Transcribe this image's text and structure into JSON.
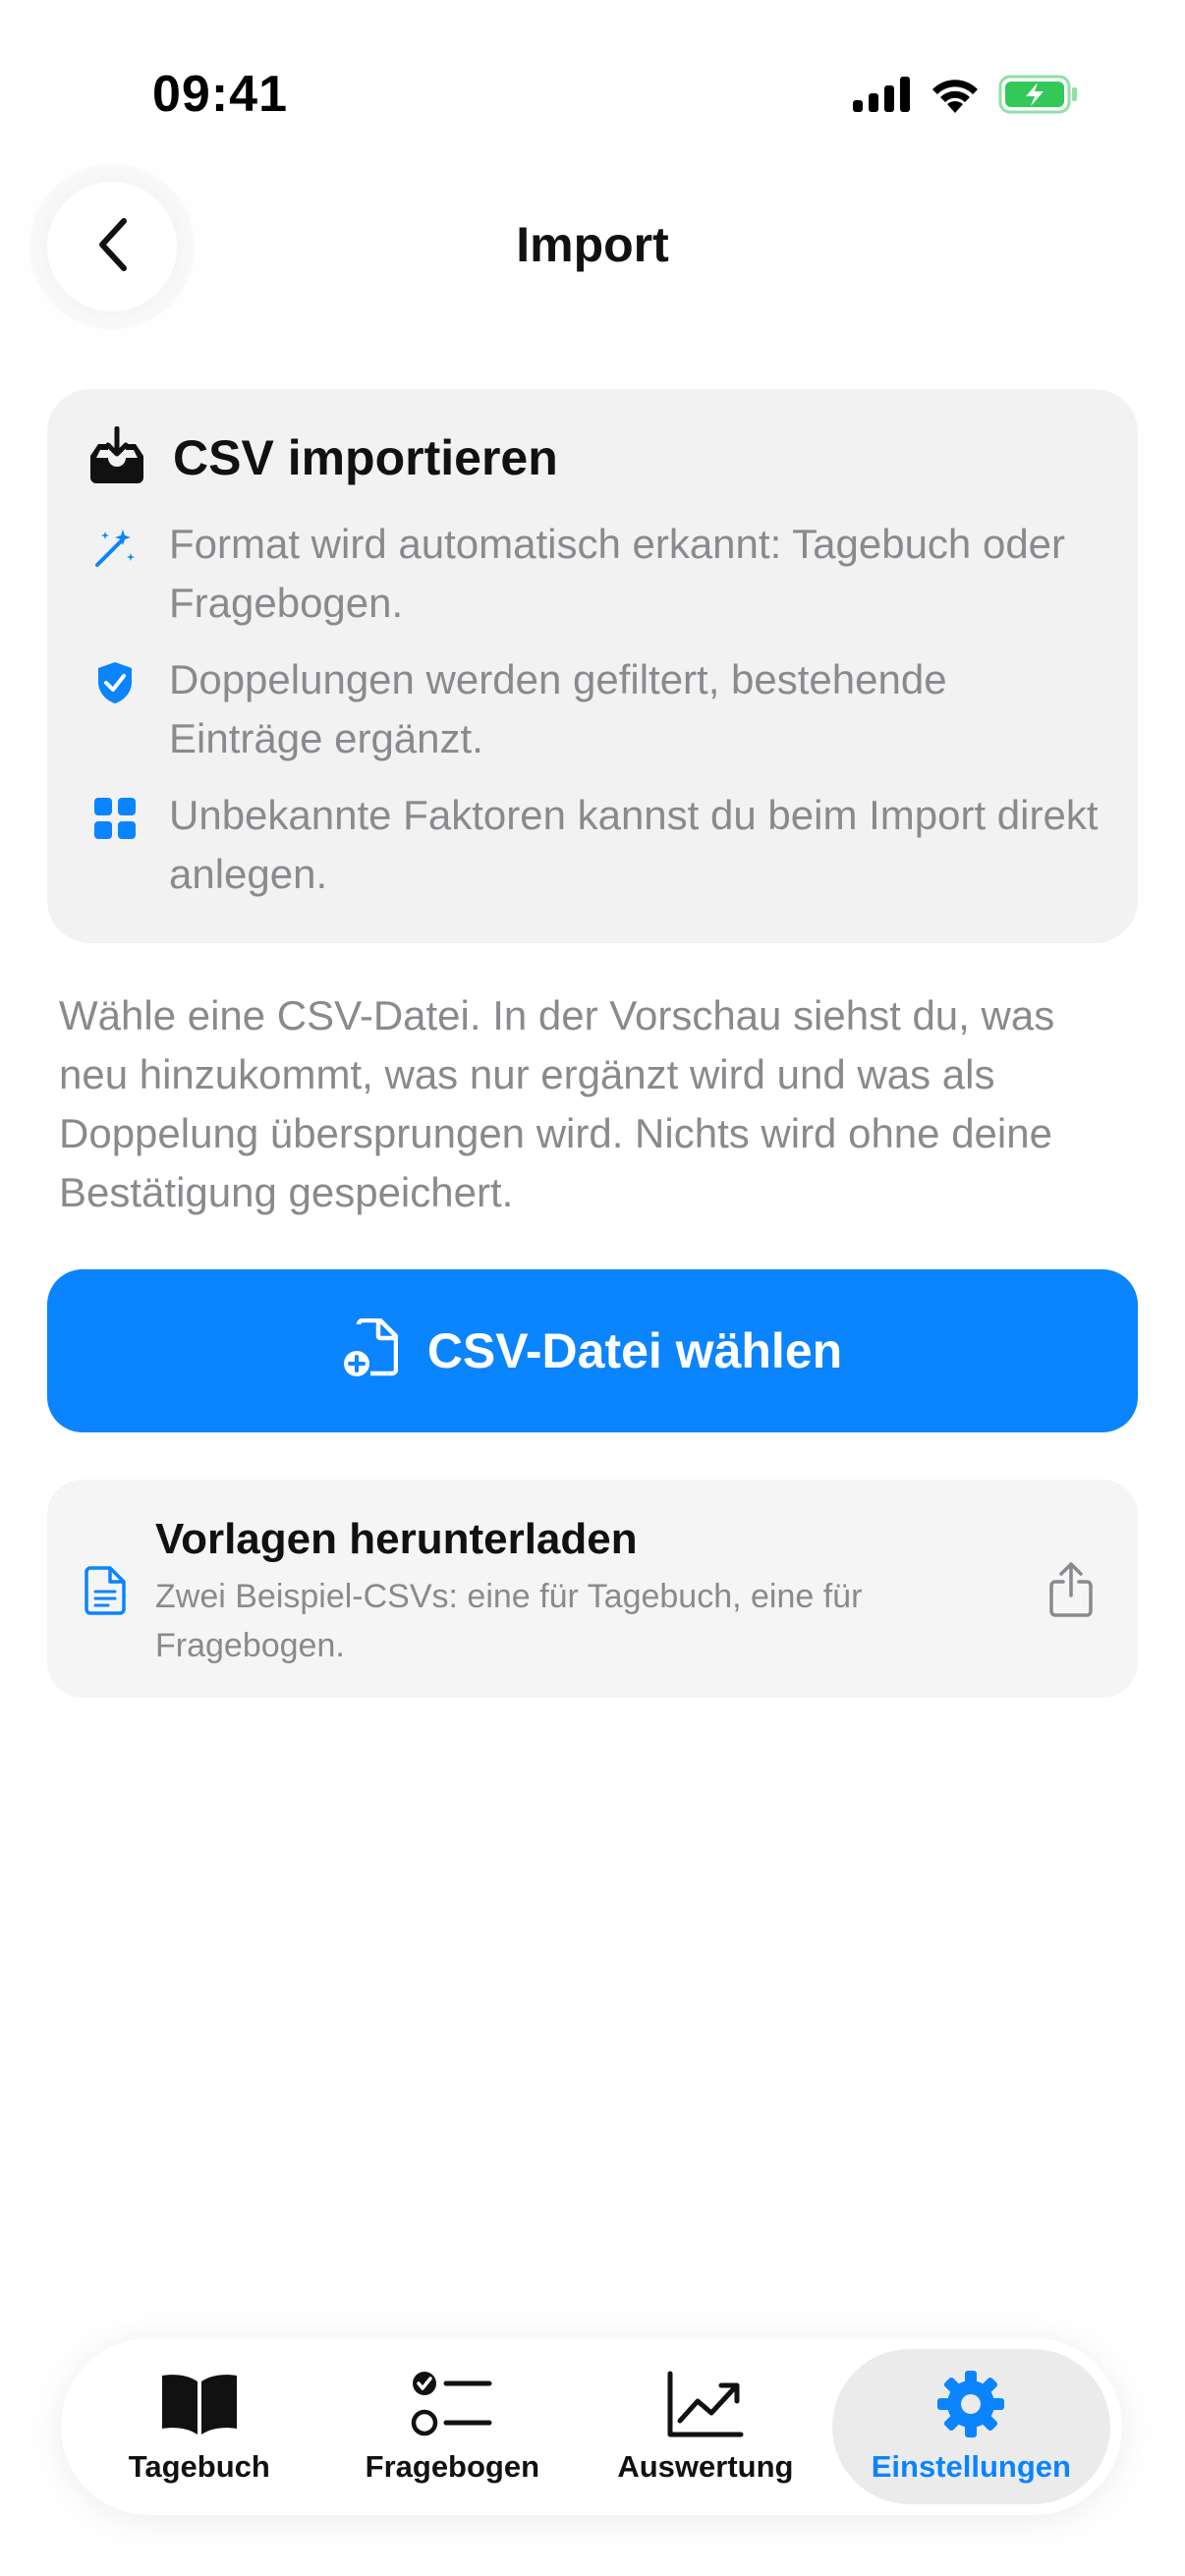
{
  "status_bar": {
    "time": "09:41"
  },
  "nav": {
    "title": "Import",
    "back_icon": "chevron-left-icon"
  },
  "info_card": {
    "title": "CSV importieren",
    "title_icon": "tray-download-icon",
    "items": [
      {
        "icon": "magic-wand-icon",
        "text": "Format wird automatisch erkannt: Tagebuch oder Fragebogen."
      },
      {
        "icon": "shield-check-icon",
        "text": "Doppelungen werden gefiltert, bestehende Einträge ergänzt."
      },
      {
        "icon": "grid-icon",
        "text": "Unbekannte Faktoren kannst du beim Import direkt anlegen."
      }
    ]
  },
  "description": "Wähle eine CSV-Datei. In der Vorschau siehst du, was neu hinzukommt, was nur ergänzt wird und was als Doppelung übersprungen wird. Nichts wird ohne deine Bestätigung gespeichert.",
  "primary_button": {
    "label": "CSV-Datei wählen",
    "icon": "document-add-icon"
  },
  "template_card": {
    "title": "Vorlagen herunterladen",
    "subtitle": "Zwei Beispiel-CSVs: eine für Tagebuch, eine für Fragebogen.",
    "icon": "document-icon",
    "action_icon": "share-icon"
  },
  "tab_bar": {
    "tabs": [
      {
        "label": "Tagebuch",
        "icon": "book-icon",
        "active": false
      },
      {
        "label": "Fragebogen",
        "icon": "checklist-icon",
        "active": false
      },
      {
        "label": "Auswertung",
        "icon": "chart-trend-icon",
        "active": false
      },
      {
        "label": "Einstellungen",
        "icon": "gear-icon",
        "active": true
      }
    ]
  },
  "colors": {
    "accent": "#0a84ff",
    "battery": "#34c759",
    "card_bg": "#f2f2f3",
    "muted_text": "#8a8a8e"
  }
}
